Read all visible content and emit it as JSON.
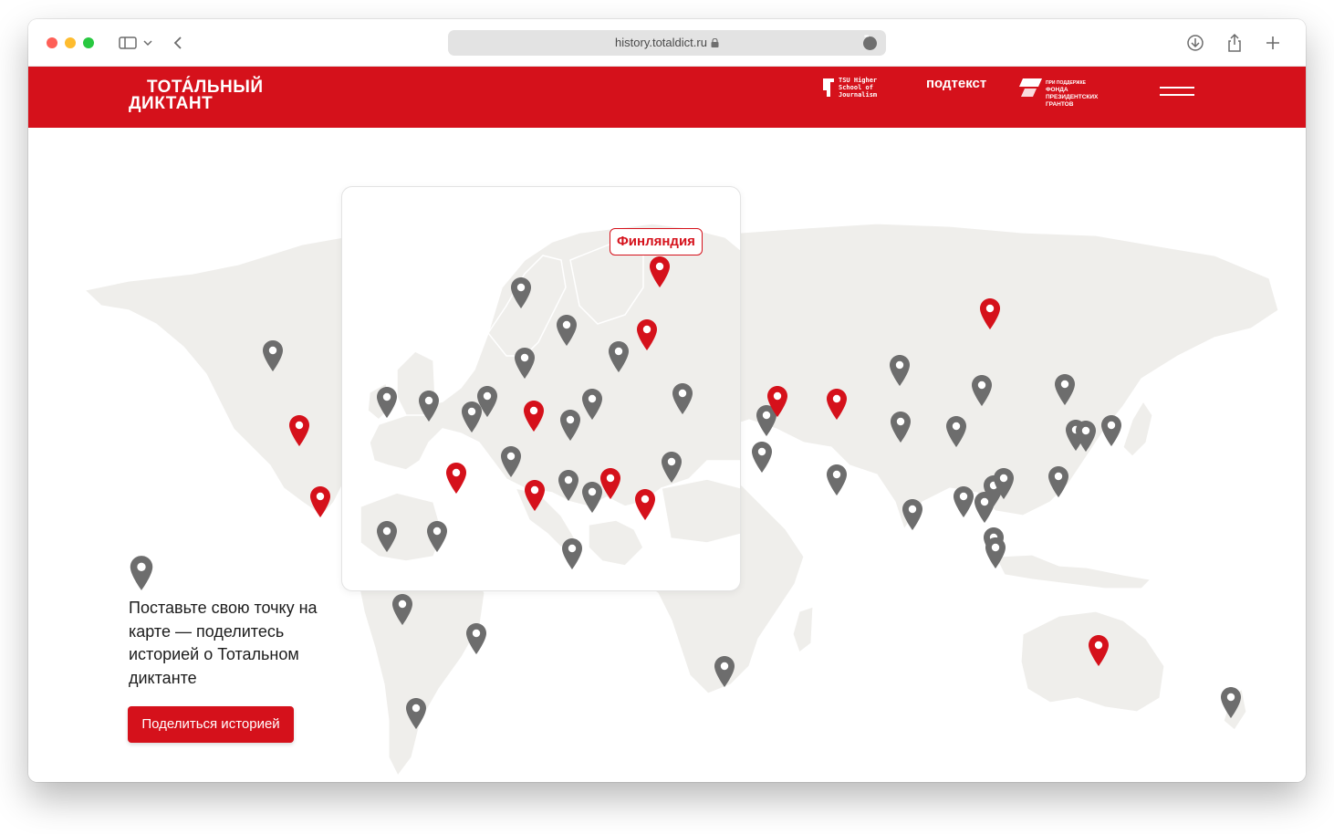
{
  "browser": {
    "url": "history.totaldict.ru"
  },
  "header": {
    "logo_line1": "ТОТА́ЛЬНЫЙ",
    "logo_line2": "ДИКТАНТ",
    "tsu_text": "TSU Higher School of Journalism",
    "podtekst_text": "подтекст",
    "fond_small": "ПРИ ПОДДЕРЖКЕ",
    "fond_text": "ФОНДА ПРЕЗИДЕНТСКИХ ГРАНТОВ"
  },
  "map": {
    "tooltip_label": "Финляндия",
    "land_color": "#efeeeb",
    "pin_red": "#d5111b",
    "pin_gray": "#6d6d6d"
  },
  "cta": {
    "text": "Поставьте свою точку на карте — поделитесь историей о Тотальном диктанте",
    "button_label": "Поделиться историей"
  }
}
